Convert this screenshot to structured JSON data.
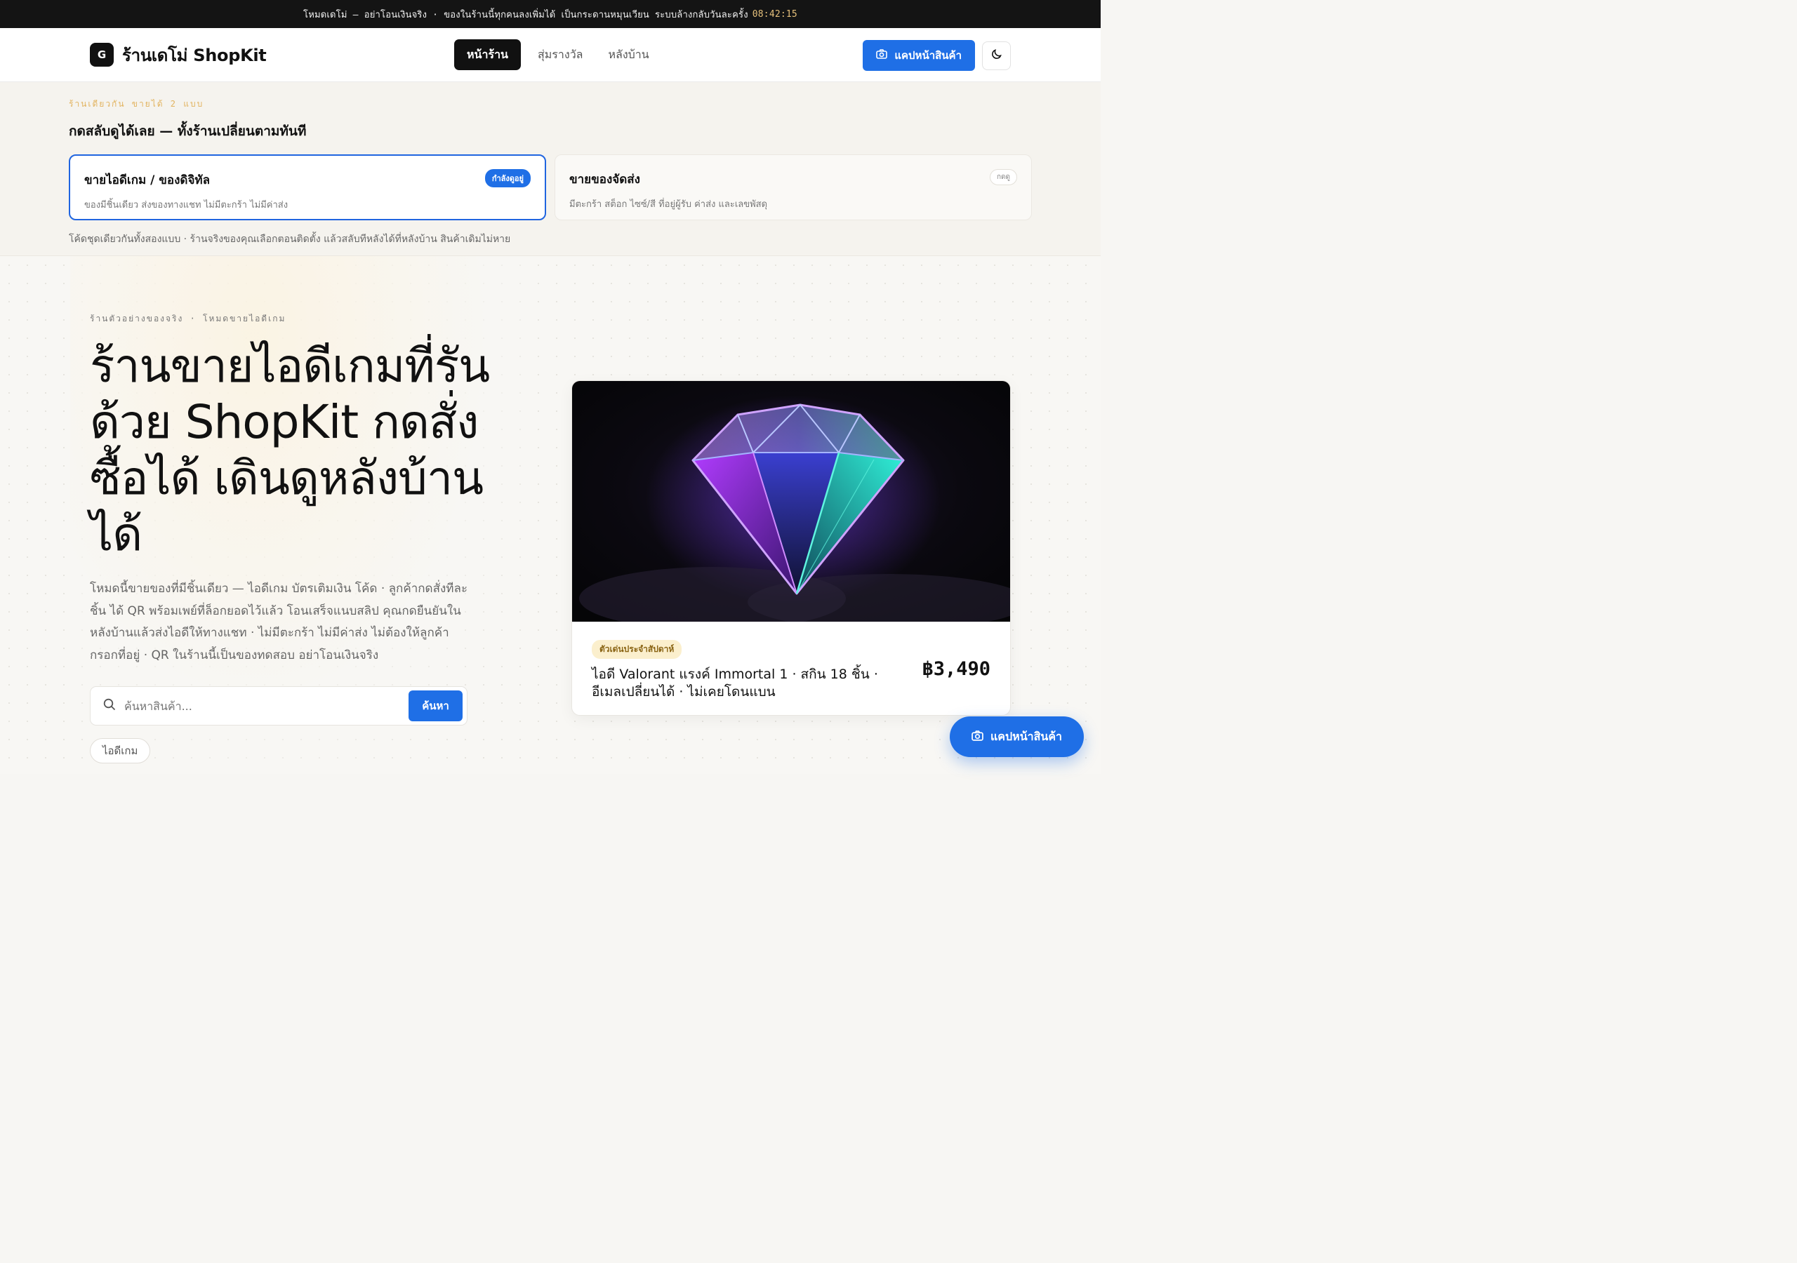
{
  "topstrip": {
    "text": "โหมดเดโม่ — อย่าโอนเงินจริง · ของในร้านนี้ทุกคนลงเพิ่มได้ เป็นกระดานหมุนเวียน ระบบล้างกลับวันละครั้ง",
    "clock": "08:42:15"
  },
  "header": {
    "logo_letter": "G",
    "brand": "ร้านเดโม่ ShopKit",
    "nav": [
      {
        "label": "หน้าร้าน",
        "active": true
      },
      {
        "label": "สุ่มรางวัล",
        "active": false
      },
      {
        "label": "หลังบ้าน",
        "active": false
      }
    ],
    "capture_button": "แคปหน้าสินค้า"
  },
  "mode_chooser": {
    "kicker": "ร้านเดียวกัน ขายได้ 2 แบบ",
    "heading": "กดสลับดูได้เลย — ทั้งร้านเปลี่ยนตามทันที",
    "cards": [
      {
        "title": "ขายไอดีเกม / ของดิจิทัล",
        "desc": "ของมีชิ้นเดียว ส่งของทางแชท ไม่มีตะกร้า ไม่มีค่าส่ง",
        "badge": "กำลังดูอยู่",
        "active": true
      },
      {
        "title": "ขายของจัดส่ง",
        "desc": "มีตะกร้า สต็อก ไซซ์/สี ที่อยู่ผู้รับ ค่าส่ง และเลขพัสดุ",
        "badge": "กดดู",
        "active": false
      }
    ],
    "note": "โค้ดชุดเดียวกันทั้งสองแบบ · ร้านจริงของคุณเลือกตอนติดตั้ง แล้วสลับทีหลังได้ที่หลังบ้าน สินค้าเดิมไม่หาย"
  },
  "hero": {
    "kicker": "ร้านตัวอย่างของจริง · โหมดขายไอดีเกม",
    "title": "ร้านขายไอดีเกมที่รันด้วย ShopKit กดสั่งซื้อได้ เดินดูหลังบ้านได้",
    "description": "โหมดนี้ขายของที่มีชิ้นเดียว — ไอดีเกม บัตรเติมเงิน โค้ด · ลูกค้ากดสั่งทีละชิ้น ได้ QR พร้อมเพย์ที่ล็อกยอดไว้แล้ว โอนเสร็จแนบสลิป คุณกดยืนยันในหลังบ้านแล้วส่งไอดีให้ทางแชท · ไม่มีตะกร้า ไม่มีค่าส่ง ไม่ต้องให้ลูกค้ากรอกที่อยู่ · QR ในร้านนี้เป็นของทดสอบ อย่าโอนเงินจริง",
    "search": {
      "placeholder": "ค้นหาสินค้า...",
      "button": "ค้นหา"
    },
    "tags": [
      "ไอดีเกม"
    ]
  },
  "featured": {
    "badge": "ตัวเด่นประจำสัปดาห์",
    "name": "ไอดี Valorant แรงค์ Immortal 1 · สกิน 18 ชิ้น · อีเมลเปลี่ยนได้ · ไม่เคยโดนแบน",
    "price": "฿3,490",
    "image_icon": "glowing-diamond-image"
  },
  "fab": {
    "label": "แคปหน้าสินค้า"
  },
  "colors": {
    "accent": "#1f6fe6",
    "dark": "#111111",
    "kicker": "#e2b35f",
    "badge_bg": "#fbefcd"
  }
}
